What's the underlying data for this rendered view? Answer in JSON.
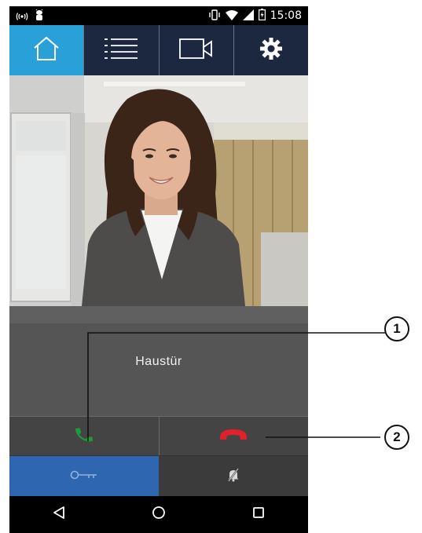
{
  "status_bar": {
    "time": "15:08",
    "icons": [
      "broadcast-icon",
      "android-debug-icon",
      "vibrate-icon",
      "wifi-icon",
      "signal-icon",
      "battery-charging-icon"
    ]
  },
  "tabs": [
    {
      "icon": "home-icon",
      "active": true
    },
    {
      "icon": "list-icon",
      "active": false
    },
    {
      "icon": "video-camera-icon",
      "active": false
    },
    {
      "icon": "gear-icon",
      "active": false
    }
  ],
  "door": {
    "name": "Haustür"
  },
  "calls": {
    "accept_icon": "phone-accept-icon",
    "decline_icon": "phone-hangup-icon",
    "accept_color": "#1e9a3a",
    "decline_color": "#e0202a"
  },
  "actions": {
    "door_icon": "key-icon",
    "mute_icon": "bell-muted-icon",
    "door_color": "#2f66b0"
  },
  "callouts": [
    "1",
    "2"
  ],
  "colors": {
    "tabbar": "#1c2740",
    "tab_active": "#2aa0d8"
  }
}
